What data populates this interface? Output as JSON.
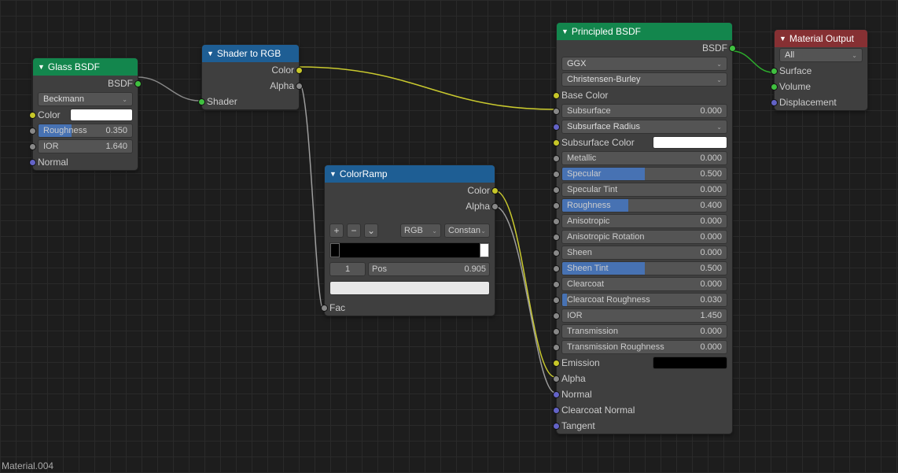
{
  "material_label": "Material.004",
  "nodes": {
    "glass": {
      "title": "Glass BSDF",
      "outputs": {
        "bsdf": "BSDF"
      },
      "dist": "Beckmann",
      "inputs": {
        "color": {
          "label": "Color"
        },
        "roughness": {
          "label": "Roughness",
          "value": "0.350",
          "pct": 35
        },
        "ior": {
          "label": "IOR",
          "value": "1.640"
        },
        "normal": {
          "label": "Normal"
        }
      }
    },
    "shader2rgb": {
      "title": "Shader to RGB",
      "outputs": {
        "color": "Color",
        "alpha": "Alpha"
      },
      "inputs": {
        "shader": "Shader"
      }
    },
    "colorramp": {
      "title": "ColorRamp",
      "outputs": {
        "color": "Color",
        "alpha": "Alpha"
      },
      "mode": "RGB",
      "interp": "Constan",
      "idx": "1",
      "pos_label": "Pos",
      "pos": "0.905",
      "inputs": {
        "fac": "Fac"
      }
    },
    "principled": {
      "title": "Principled BSDF",
      "outputs": {
        "bsdf": "BSDF"
      },
      "dist": "GGX",
      "sss_method": "Christensen-Burley",
      "inputs": {
        "base_color": {
          "label": "Base Color"
        },
        "subsurface": {
          "label": "Subsurface",
          "value": "0.000",
          "pct": 0
        },
        "sss_radius": {
          "label": "Subsurface Radius"
        },
        "sss_color": {
          "label": "Subsurface Color"
        },
        "metallic": {
          "label": "Metallic",
          "value": "0.000",
          "pct": 0
        },
        "specular": {
          "label": "Specular",
          "value": "0.500",
          "pct": 50
        },
        "specular_tint": {
          "label": "Specular Tint",
          "value": "0.000",
          "pct": 0
        },
        "roughness": {
          "label": "Roughness",
          "value": "0.400",
          "pct": 40
        },
        "anisotropic": {
          "label": "Anisotropic",
          "value": "0.000",
          "pct": 0
        },
        "aniso_rot": {
          "label": "Anisotropic Rotation",
          "value": "0.000",
          "pct": 0
        },
        "sheen": {
          "label": "Sheen",
          "value": "0.000",
          "pct": 0
        },
        "sheen_tint": {
          "label": "Sheen Tint",
          "value": "0.500",
          "pct": 50
        },
        "clearcoat": {
          "label": "Clearcoat",
          "value": "0.000",
          "pct": 0
        },
        "clearcoat_rough": {
          "label": "Clearcoat Roughness",
          "value": "0.030",
          "pct": 3
        },
        "ior": {
          "label": "IOR",
          "value": "1.450"
        },
        "transmission": {
          "label": "Transmission",
          "value": "0.000",
          "pct": 0
        },
        "trans_rough": {
          "label": "Transmission Roughness",
          "value": "0.000",
          "pct": 0
        },
        "emission": {
          "label": "Emission"
        },
        "alpha": {
          "label": "Alpha"
        },
        "normal": {
          "label": "Normal"
        },
        "clearcoat_normal": {
          "label": "Clearcoat Normal"
        },
        "tangent": {
          "label": "Tangent"
        }
      }
    },
    "output": {
      "title": "Material Output",
      "target": "All",
      "inputs": {
        "surface": "Surface",
        "volume": "Volume",
        "displacement": "Displacement"
      }
    }
  }
}
